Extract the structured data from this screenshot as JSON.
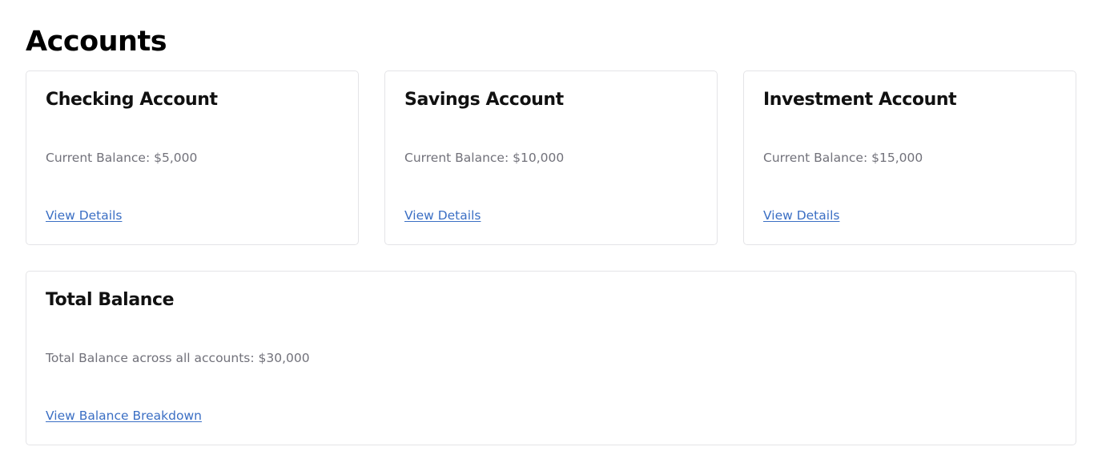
{
  "page": {
    "title": "Accounts"
  },
  "accounts": [
    {
      "title": "Checking Account",
      "balance_text": "Current Balance: $5,000",
      "link_label": "View Details"
    },
    {
      "title": "Savings Account",
      "balance_text": "Current Balance: $10,000",
      "link_label": "View Details"
    },
    {
      "title": "Investment Account",
      "balance_text": "Current Balance: $15,000",
      "link_label": "View Details"
    }
  ],
  "total": {
    "title": "Total Balance",
    "balance_text": "Total Balance across all accounts: $30,000",
    "link_label": "View Balance Breakdown"
  },
  "colors": {
    "link": "#3b6fc4",
    "muted_text": "#71717a",
    "border": "#e4e4e7"
  }
}
